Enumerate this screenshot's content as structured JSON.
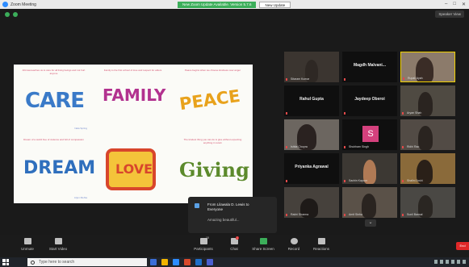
{
  "window": {
    "title": "Zoom Meeting",
    "min": "–",
    "max": "□",
    "close": "✕"
  },
  "update_banner": {
    "message": "New Zoom Update Available. Version 5.7.6",
    "button": "New Update"
  },
  "speaker_view": "Speaker View",
  "share": {
    "panels": [
      {
        "word": "CARE",
        "caption": "Ahimsa teaches us to care for all living beings and not hurt anyone",
        "tag": "Nala Spring",
        "color": "#3a7ac8"
      },
      {
        "word": "FAMILY",
        "caption": "Family is the first school of love and respect for elders",
        "tag": "",
        "color": "#b2328f"
      },
      {
        "word": "PEACE",
        "caption": "Peace begins when we choose kindness over anger",
        "tag": "",
        "color": "#e8a21c"
      },
      {
        "word": "DREAM",
        "caption": "Dream of a world free of violence and full of compassion",
        "tag": "Arjun Mehta",
        "color": "#2f6fbd"
      },
      {
        "word": "LOVE",
        "caption": "Love and kindness are the true signs of a non-violent heart",
        "tag": "",
        "color": "#d8462c"
      },
      {
        "word": "Giving",
        "caption": "The kindest thing you can do is give without expecting anything in return",
        "tag": "",
        "color": "#5c8a2c"
      }
    ]
  },
  "participants": [
    {
      "name": "Sitaram Kumar",
      "label": "",
      "type": "video",
      "bg": "#5d5147"
    },
    {
      "name": "",
      "label": "Magdh Malvani...",
      "type": "text",
      "bg": "#0f0f0f"
    },
    {
      "name": "Rupali Ayah",
      "label": "",
      "type": "video",
      "bg": "#8c7b6b"
    },
    {
      "name": "",
      "label": "Rahul Gupta",
      "type": "text",
      "bg": "#0f0f0f"
    },
    {
      "name": "",
      "label": "Jaydeep Oberoi",
      "type": "text",
      "bg": "#0f0f0f"
    },
    {
      "name": "Aryan Shah",
      "label": "",
      "type": "video",
      "bg": "#4f4a42"
    },
    {
      "name": "Ishita Chopra",
      "label": "",
      "type": "video",
      "bg": "#6c6660"
    },
    {
      "name": "Shubham Singh",
      "label": "S",
      "type": "avatar",
      "bg": "#0f0f0f"
    },
    {
      "name": "Ridhi Rao",
      "label": "",
      "type": "video",
      "bg": "#524b45"
    },
    {
      "name": "",
      "label": "Priyanka Agrawal",
      "type": "text",
      "bg": "#0f0f0f"
    },
    {
      "name": "Sachin Kapoor",
      "label": "",
      "type": "video",
      "bg": "#3c3833"
    },
    {
      "name": "Shalini Joshi",
      "label": "",
      "type": "video",
      "bg": "#8a6a3a"
    },
    {
      "name": "Rakhi Sharma",
      "label": "",
      "type": "video",
      "bg": "#46413c"
    },
    {
      "name": "Amit Sinha",
      "label": "",
      "type": "video",
      "bg": "#5a5148"
    },
    {
      "name": "Sunil Bansal",
      "label": "",
      "type": "video",
      "bg": "#4a4844"
    }
  ],
  "chat_popup": {
    "from": "From Lilawala D. Lewis to Everyone",
    "message": "Amazing beautiful..."
  },
  "gallery_nav": "⌄",
  "toolbar": {
    "unmute": "Unmute",
    "start_video": "Start Video",
    "participants": "Participants",
    "participants_count": "15",
    "chat": "Chat",
    "chat_badge": "1",
    "share_screen": "Share Screen",
    "record": "Record",
    "reactions": "Reactions",
    "end": "End"
  },
  "taskbar": {
    "search_placeholder": "Type here to search"
  }
}
